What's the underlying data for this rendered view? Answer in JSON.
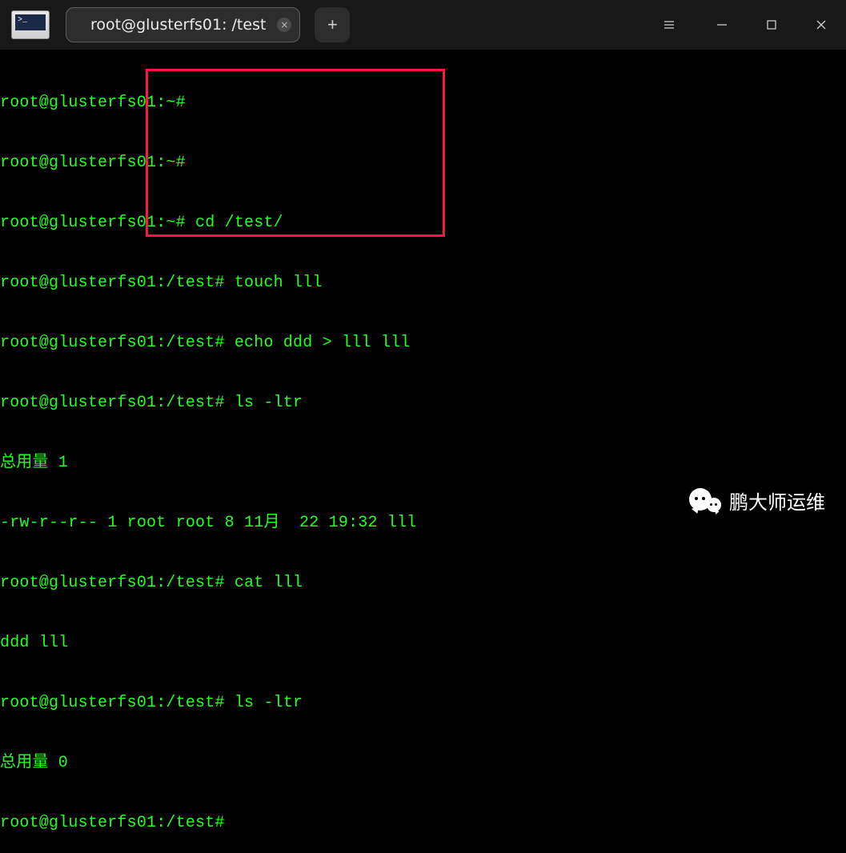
{
  "title_bar": {
    "tab_title": "root@glusterfs01: /test",
    "tab_close_glyph": "×",
    "new_tab_glyph": "+"
  },
  "terminal": {
    "lines": [
      "root@glusterfs01:~#",
      "root@glusterfs01:~#",
      "root@glusterfs01:~# cd /test/",
      "root@glusterfs01:/test# touch lll",
      "root@glusterfs01:/test# echo ddd > lll lll",
      "root@glusterfs01:/test# ls -ltr",
      "总用量 1",
      "-rw-r--r-- 1 root root 8 11月  22 19:32 lll",
      "root@glusterfs01:/test# cat lll",
      "ddd lll",
      "root@glusterfs01:/test# ls -ltr",
      "总用量 0",
      "root@glusterfs01:/test#"
    ]
  },
  "watermark": {
    "text": "鹏大师运维"
  },
  "colors": {
    "terminal_fg": "#22ff22",
    "terminal_bg": "#000000",
    "title_bg": "#181818",
    "highlight_border": "#ff1744"
  }
}
